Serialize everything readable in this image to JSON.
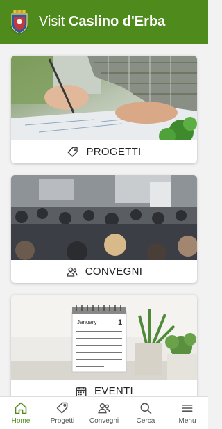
{
  "header": {
    "title_prefix": "Visit",
    "title_name": "Caslino d'Erba",
    "crest_icon": "municipal-crest-icon"
  },
  "cards": [
    {
      "label": "PROGETTI",
      "icon": "tag-icon",
      "image": "hands writing on architectural plans"
    },
    {
      "label": "CONVEGNI",
      "icon": "people-icon",
      "image": "audience at a conference"
    },
    {
      "label": "EVENTI",
      "icon": "calendar-icon",
      "image": "desk calendar with plants"
    }
  ],
  "bottom_nav": [
    {
      "label": "Home",
      "icon": "home-icon",
      "active": true
    },
    {
      "label": "Progetti",
      "icon": "tag-icon",
      "active": false
    },
    {
      "label": "Convegni",
      "icon": "people-icon",
      "active": false
    },
    {
      "label": "Cerca",
      "icon": "search-icon",
      "active": false
    },
    {
      "label": "Menu",
      "icon": "menu-icon",
      "active": false
    }
  ],
  "calendar": {
    "month": "January",
    "day": "1"
  },
  "colors": {
    "brand_green": "#4f8a1c",
    "nav_active": "#4f8a1c",
    "nav_inactive": "#555555"
  }
}
